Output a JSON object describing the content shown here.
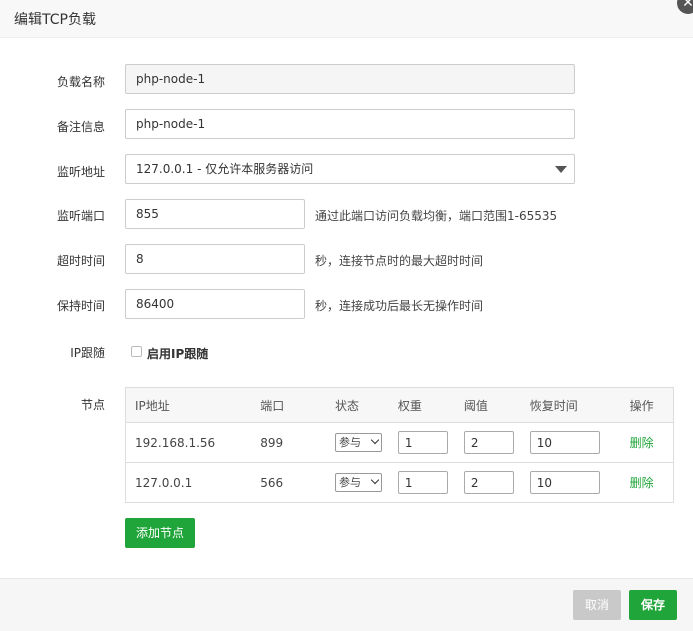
{
  "dialog": {
    "title": "编辑TCP负载",
    "close_icon": "close-icon"
  },
  "form": {
    "name": {
      "label": "负载名称",
      "value": "php-node-1"
    },
    "remark": {
      "label": "备注信息",
      "value": "php-node-1"
    },
    "listen_address": {
      "label": "监听地址",
      "value": "127.0.0.1 - 仅允许本服务器访问"
    },
    "listen_port": {
      "label": "监听端口",
      "value": "855",
      "hint": "通过此端口访问负载均衡，端口范围1-65535"
    },
    "timeout": {
      "label": "超时时间",
      "value": "8",
      "hint": "秒，连接节点时的最大超时时间"
    },
    "keepalive": {
      "label": "保持时间",
      "value": "86400",
      "hint": "秒，连接成功后最长无操作时间"
    },
    "ip_follow": {
      "label": "IP跟随",
      "checkbox_label": "启用IP跟随",
      "checked": false
    },
    "nodes_label": "节点"
  },
  "nodes_table": {
    "headers": [
      "IP地址",
      "端口",
      "状态",
      "权重",
      "阈值",
      "恢复时间",
      "操作"
    ],
    "rows": [
      {
        "ip": "192.168.1.56",
        "port": "899",
        "status": "参与",
        "weight": "1",
        "threshold": "2",
        "recover": "10",
        "action": "删除"
      },
      {
        "ip": "127.0.0.1",
        "port": "566",
        "status": "参与",
        "weight": "1",
        "threshold": "2",
        "recover": "10",
        "action": "删除"
      }
    ]
  },
  "add_node_label": "添加节点",
  "footer": {
    "cancel_label": "取消",
    "save_label": "保存"
  },
  "colors": {
    "accent": "#20a53a",
    "cancel": "#c9c9c9"
  }
}
